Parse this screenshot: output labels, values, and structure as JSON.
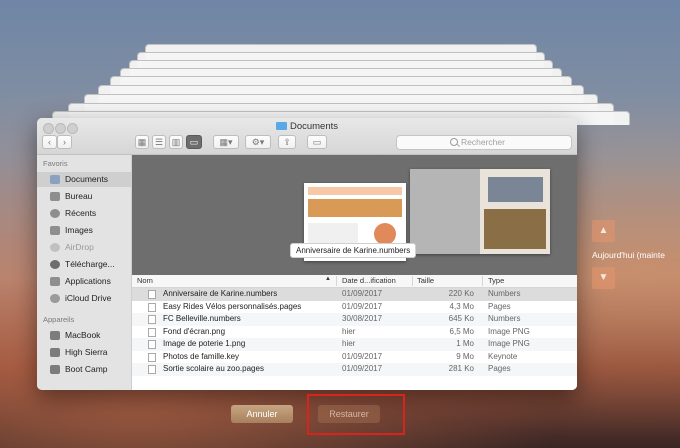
{
  "window": {
    "title": "Documents"
  },
  "toolbar": {
    "back_icon": "chevron-left-icon",
    "forward_icon": "chevron-right-icon",
    "search_placeholder": "Rechercher"
  },
  "sidebar": {
    "favorites_header": "Favoris",
    "favorites": [
      {
        "label": "Documents",
        "icon": "documents-icon",
        "selected": true
      },
      {
        "label": "Bureau",
        "icon": "desktop-icon"
      },
      {
        "label": "Récents",
        "icon": "clock-icon"
      },
      {
        "label": "Images",
        "icon": "camera-icon"
      },
      {
        "label": "AirDrop",
        "icon": "airdrop-icon",
        "dim": true
      },
      {
        "label": "Télécharge...",
        "icon": "download-icon"
      },
      {
        "label": "Applications",
        "icon": "applications-icon"
      },
      {
        "label": "iCloud Drive",
        "icon": "cloud-icon"
      }
    ],
    "devices_header": "Appareils",
    "devices": [
      {
        "label": "MacBook",
        "icon": "laptop-icon"
      },
      {
        "label": "High Sierra",
        "icon": "disk-icon"
      },
      {
        "label": "Boot Camp",
        "icon": "disk-icon"
      }
    ]
  },
  "preview": {
    "label": "Anniversaire de Karine.numbers"
  },
  "columns": {
    "name": "Nom",
    "date": "Date d...ification",
    "size": "Taille",
    "kind": "Type"
  },
  "files": [
    {
      "name": "Anniversaire de Karine.numbers",
      "date": "01/09/2017",
      "size": "220 Ko",
      "kind": "Numbers",
      "selected": true
    },
    {
      "name": "Easy Rides Vélos personnalisés.pages",
      "date": "01/09/2017",
      "size": "4,3 Mo",
      "kind": "Pages"
    },
    {
      "name": "FC Belleville.numbers",
      "date": "30/08/2017",
      "size": "645 Ko",
      "kind": "Numbers"
    },
    {
      "name": "Fond d'écran.png",
      "date": "hier",
      "size": "6,5 Mo",
      "kind": "Image PNG"
    },
    {
      "name": "Image de poterie 1.png",
      "date": "hier",
      "size": "1 Mo",
      "kind": "Image PNG"
    },
    {
      "name": "Photos de famille.key",
      "date": "01/09/2017",
      "size": "9 Mo",
      "kind": "Keynote"
    },
    {
      "name": "Sortie scolaire au zoo.pages",
      "date": "01/09/2017",
      "size": "281 Ko",
      "kind": "Pages"
    }
  ],
  "timeline": {
    "label": "Aujourd'hui (mainte"
  },
  "buttons": {
    "cancel": "Annuler",
    "restore": "Restaurer"
  }
}
